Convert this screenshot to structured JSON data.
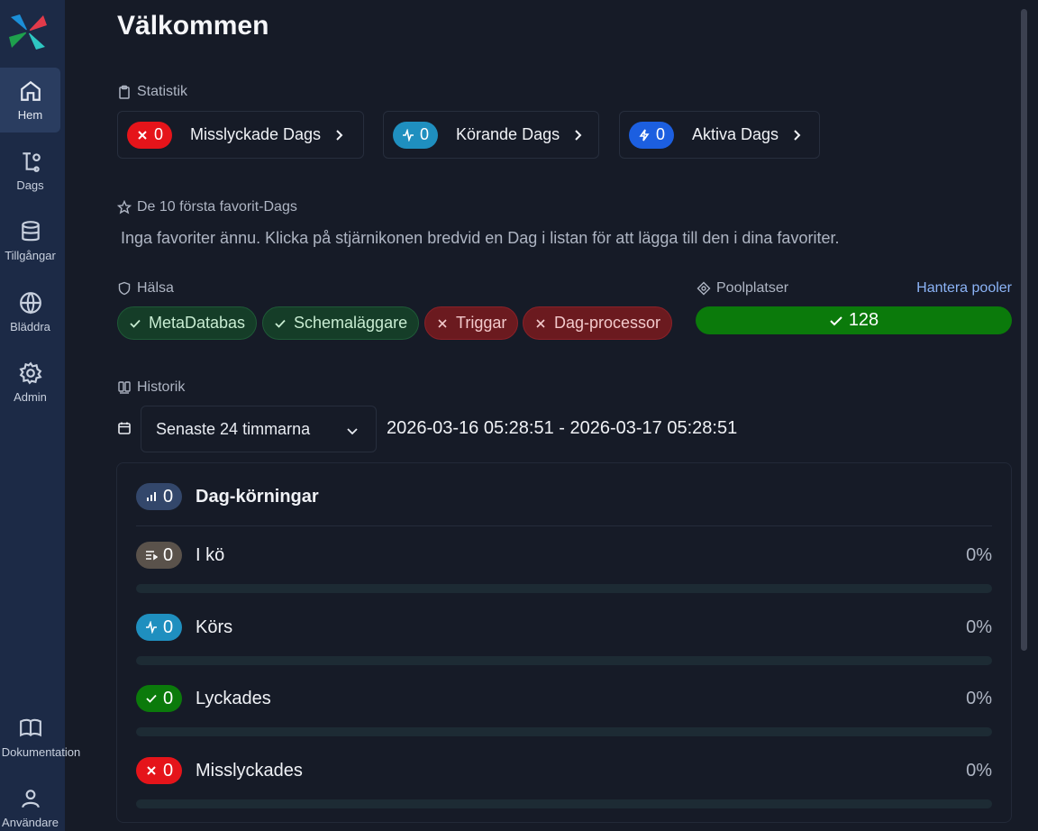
{
  "nav": {
    "items": [
      {
        "key": "home",
        "label": "Hem",
        "icon": "home-icon"
      },
      {
        "key": "dags",
        "label": "Dags",
        "icon": "dags-icon"
      },
      {
        "key": "assets",
        "label": "Tillgångar",
        "icon": "database-icon"
      },
      {
        "key": "browse",
        "label": "Bläddra",
        "icon": "globe-icon"
      },
      {
        "key": "admin",
        "label": "Admin",
        "icon": "gear-icon"
      }
    ],
    "bottom_items": [
      {
        "key": "docs",
        "label": "Dokumentation",
        "icon": "book-icon"
      },
      {
        "key": "user",
        "label": "Användare",
        "icon": "user-icon"
      }
    ]
  },
  "page": {
    "title": "Välkommen"
  },
  "stats": {
    "label": "Statistik",
    "cards": [
      {
        "count": "0",
        "label": "Misslyckade Dags",
        "color": "#e5141a",
        "icon": "x-icon"
      },
      {
        "count": "0",
        "label": "Körande Dags",
        "color": "#1f8fbf",
        "icon": "activity-icon"
      },
      {
        "count": "0",
        "label": "Aktiva Dags",
        "color": "#1c5fe0",
        "icon": "lightning-icon"
      }
    ]
  },
  "favorites": {
    "label": "De 10 första favorit-Dags",
    "empty_message": "Inga favoriter ännu. Klicka på stjärnikonen bredvid en Dag i listan för att lägga till den i dina favoriter."
  },
  "health": {
    "label": "Hälsa",
    "items": [
      {
        "label": "MetaDatabas",
        "status": "ok"
      },
      {
        "label": "Schemaläggare",
        "status": "ok"
      },
      {
        "label": "Triggar",
        "status": "error"
      },
      {
        "label": "Dag-processor",
        "status": "error"
      }
    ]
  },
  "pools": {
    "label": "Poolplatser",
    "manage_link": "Hantera pooler",
    "count": "128",
    "color": "#0b7a0b"
  },
  "history": {
    "label": "Historik",
    "range_select": "Senaste 24 timmarna",
    "date_range": "2026-03-16 05:28:51 - 2026-03-17 05:28:51",
    "total": {
      "count": "0",
      "label": "Dag-körningar",
      "color": "#33476b"
    },
    "states": [
      {
        "count": "0",
        "label": "I kö",
        "percent": "0%",
        "fraction": 0,
        "color": "#5a524b",
        "icon": "queue-icon"
      },
      {
        "count": "0",
        "label": "Körs",
        "percent": "0%",
        "fraction": 0,
        "color": "#1f8fbf",
        "icon": "activity-icon"
      },
      {
        "count": "0",
        "label": "Lyckades",
        "percent": "0%",
        "fraction": 0,
        "color": "#0b7a0b",
        "icon": "check-icon"
      },
      {
        "count": "0",
        "label": "Misslyckades",
        "percent": "0%",
        "fraction": 0,
        "color": "#e5141a",
        "icon": "x-icon"
      }
    ]
  }
}
